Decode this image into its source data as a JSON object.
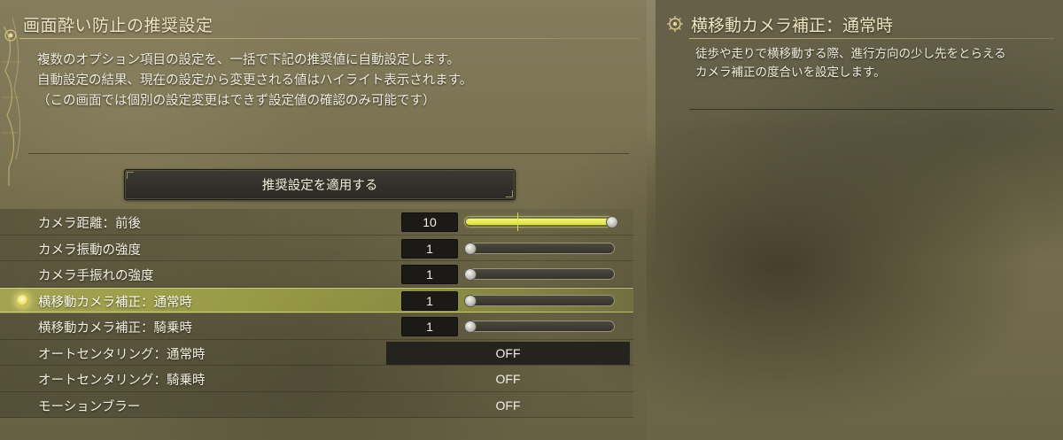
{
  "main": {
    "title": "画面酔い防止の推奨設定",
    "description": [
      "複数のオプション項目の設定を、一括で下記の推奨値に自動設定します。",
      "自動設定の結果、現在の設定から変更される値はハイライト表示されます。",
      "（この画面では個別の設定変更はできず設定値の確認のみ可能です）"
    ],
    "apply_button_label": "推奨設定を適用する"
  },
  "settings": [
    {
      "label": "カメラ距離：前後",
      "type": "slider",
      "value": "10",
      "level": 1.0,
      "default_level": 0.35,
      "highlighted": true
    },
    {
      "label": "カメラ振動の強度",
      "type": "slider",
      "value": "1",
      "level": 0.0
    },
    {
      "label": "カメラ手振れの強度",
      "type": "slider",
      "value": "1",
      "level": 0.0
    },
    {
      "label": "横移動カメラ補正：通常時",
      "type": "slider",
      "value": "1",
      "level": 0.0,
      "selected": true
    },
    {
      "label": "横移動カメラ補正：騎乗時",
      "type": "slider",
      "value": "1",
      "level": 0.0
    },
    {
      "label": "オートセンタリング：通常時",
      "type": "toggle",
      "value": "OFF",
      "dark": true
    },
    {
      "label": "オートセンタリング：騎乗時",
      "type": "toggle",
      "value": "OFF"
    },
    {
      "label": "モーションブラー",
      "type": "toggle",
      "value": "OFF"
    }
  ],
  "help": {
    "title": "横移動カメラ補正：通常時",
    "description": [
      "徒歩や走りで横移動する際、進行方向の少し先をとらえる",
      "カメラ補正の度合いを設定します。"
    ]
  },
  "colors": {
    "accent_yellow": "#d8e23c",
    "title_gold": "#f0e6c2",
    "value_box": "#1b1a16"
  },
  "icons": {
    "left_emblem": "ornate-emblem-icon",
    "cursor": "selection-dot-icon",
    "help_title": "gear-sun-icon"
  }
}
